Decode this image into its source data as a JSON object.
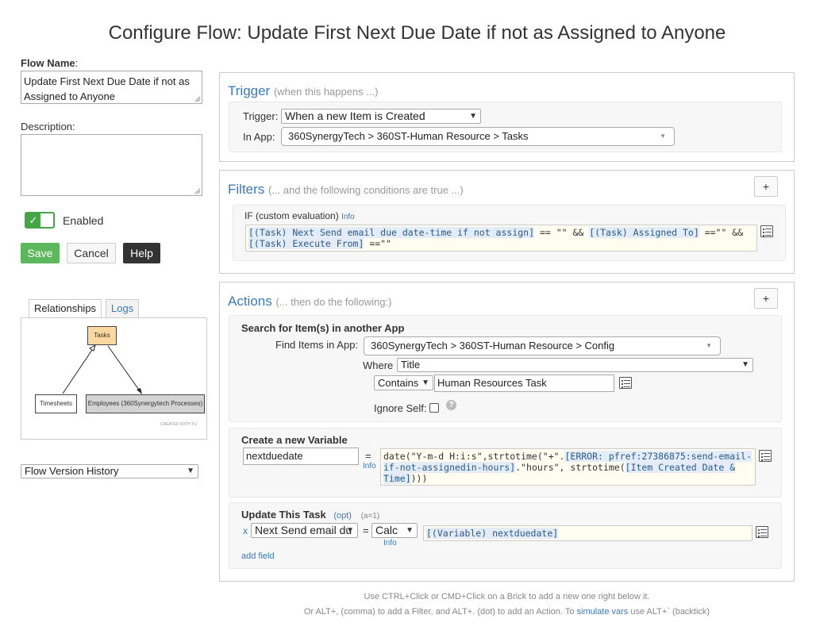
{
  "page_title": "Configure Flow: Update First Next Due Date if not as Assigned to Anyone",
  "left": {
    "flow_name_label": "Flow Name",
    "flow_name_colon": ":",
    "flow_name_value": "Update First Next Due Date if not as Assigned to Anyone",
    "description_label": "Description:",
    "description_value": "",
    "enabled_label": "Enabled",
    "save_label": "Save",
    "cancel_label": "Cancel",
    "help_label": "Help",
    "tabs": [
      "Relationships",
      "Logs"
    ],
    "diagram": {
      "nodes": [
        "Tasks",
        "Timesheets",
        "Employees (360Synergytech Processes)"
      ],
      "credit": "CREATED WITH YU"
    },
    "version_history_label": "Flow Version History"
  },
  "trigger": {
    "title": "Trigger",
    "subtitle": "(when this happens ...)",
    "trigger_label": "Trigger:",
    "trigger_value": "When a new Item is Created",
    "app_label": "In App:",
    "app_value": "360SynergyTech > 360ST-Human Resource > Tasks"
  },
  "filters": {
    "title": "Filters",
    "subtitle": "(... and the following conditions are true ...)",
    "add_label": "+",
    "if_label": "IF (custom evaluation)",
    "info_label": "Info",
    "expr": {
      "p1": "[(Task) Next Send email due date-time if not assign]",
      "p2": " == \"\" && ",
      "p3": "[(Task) Assigned To]",
      "p4": " ==\"\" &&",
      "p5": "[(Task) Execute From]",
      "p6": " ==\"\""
    }
  },
  "actions": {
    "title": "Actions",
    "subtitle": "(... then do the following:)",
    "add_label": "+",
    "search": {
      "title": "Search for Item(s) in another App",
      "find_label": "Find Items in App:",
      "find_value": "360SynergyTech > 360ST-Human Resource > Config",
      "where_label": "Where",
      "where_value": "Title",
      "op_value": "Contains",
      "match_value": "Human Resources Task",
      "ignore_self_label": "Ignore Self:",
      "help_symbol": "?"
    },
    "variable": {
      "title": "Create a new Variable",
      "name_value": "nextduedate",
      "equals": "=",
      "info_label": "Info",
      "expr": {
        "p1": "date(\"Y-m-d H:i:s\",strtotime(\"+\".",
        "p2": "[ERROR: pfref:27386875:send-email-if-not-assignedin-hours]",
        "p3": ".\"hours\", strtotime(",
        "p4": "[Item Created Date & Time]",
        "p5": ")))"
      }
    },
    "update": {
      "title": "Update This Task",
      "opt_label": "(opt)",
      "count_label": "(a=1)",
      "remove_symbol": "x",
      "field_value": "Next Send email du",
      "equals": "=",
      "calc_value": "Calc",
      "info_label": "Info",
      "expr": "[(Variable) nextduedate]",
      "add_field_label": "add field"
    }
  },
  "footer": {
    "line1": "Use CTRL+Click or CMD+Click on a Brick to add a new one right below it.",
    "line2_a": "Or ALT+, (comma) to add a Filter, and ALT+. (dot) to add an Action. To ",
    "line2_link": "simulate vars",
    "line2_b": " use ALT+` (backtick)"
  }
}
